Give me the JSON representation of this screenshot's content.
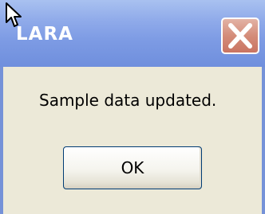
{
  "window": {
    "title": "LARA",
    "close_icon": "close-x-icon"
  },
  "dialog": {
    "message": "Sample data updated.",
    "ok_label": "OK"
  },
  "cursor": {
    "icon": "mouse-pointer-icon"
  },
  "colors": {
    "titlebar": "#7d9be4",
    "close_button": "#d48c79",
    "dialog_background": "#ece9d8",
    "button_border": "#003c74"
  }
}
